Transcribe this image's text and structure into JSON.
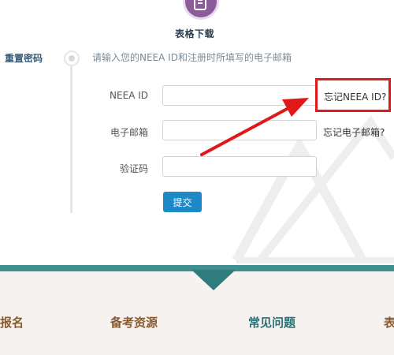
{
  "header": {
    "download_label": "表格下载",
    "icon": "document-icon",
    "icon_color": "#8d5a9b"
  },
  "step": {
    "title": "重置密码"
  },
  "form": {
    "instruction": "请输入您的NEEA ID和注册时所填写的电子邮箱",
    "fields": [
      {
        "label": "NEEA ID",
        "value": "",
        "placeholder": ""
      },
      {
        "label": "电子邮箱",
        "value": "",
        "placeholder": ""
      },
      {
        "label": "验证码",
        "value": "",
        "placeholder": ""
      }
    ],
    "forgot_id_link": "忘记NEEA ID?",
    "forgot_email_link": "忘记电子邮箱?",
    "submit_label": "提交",
    "submit_color": "#1d89c7"
  },
  "annotation": {
    "color": "#e01818"
  },
  "footer": {
    "band_color": "#3f8e90",
    "nav": [
      {
        "label": "报名",
        "color": "#8a5a2e"
      },
      {
        "label": "备考资源",
        "color": "#8a5a2e"
      },
      {
        "label": "常见问题",
        "color": "#2d6e72"
      },
      {
        "label": "表",
        "color": "#8a5a2e"
      }
    ]
  }
}
